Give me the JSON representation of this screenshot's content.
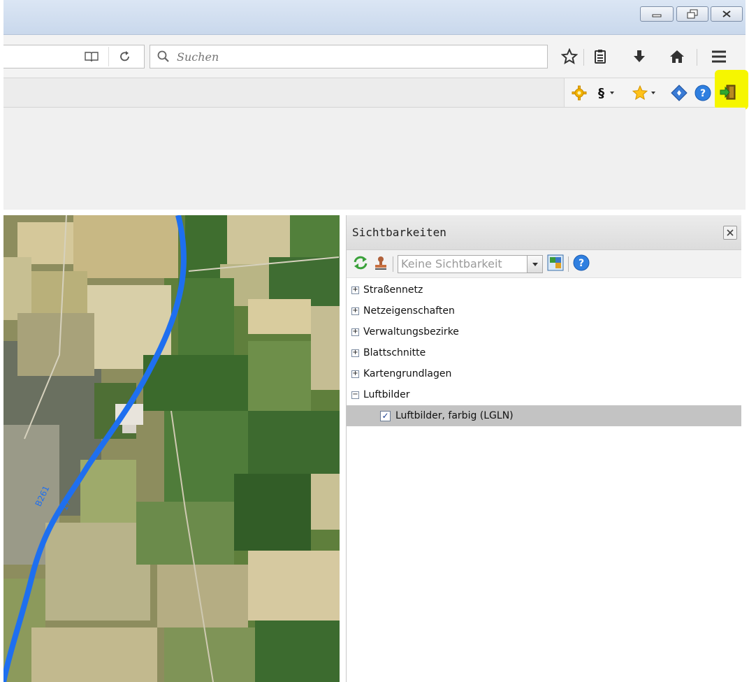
{
  "window": {
    "minimize_icon": "minimize-icon",
    "restore_icon": "restore-icon",
    "close_icon": "close-icon"
  },
  "navbar": {
    "search_placeholder": "Suchen",
    "icons": [
      "reader-view-icon",
      "reload-icon",
      "search-icon",
      "bookmark-star-icon",
      "bookmarks-list-icon",
      "download-icon",
      "home-icon",
      "menu-icon"
    ]
  },
  "addon_toolbar": {
    "paragraph_label": "§",
    "icons": [
      "settings-icon",
      "paragraph-icon",
      "favorites-star-icon",
      "navigation-diamond-icon",
      "help-icon",
      "login-icon"
    ],
    "highlight_color": "#f6f600"
  },
  "map": {
    "road_label_1": "B261",
    "road_label_2": "17",
    "road_color": "#1e6ff0"
  },
  "panel": {
    "title": "Sichtbarkeiten",
    "select_placeholder": "Keine Sichtbarkeit",
    "tree": [
      {
        "label": "Straßennetz",
        "toggle": "+"
      },
      {
        "label": "Netzeigenschaften",
        "toggle": "+"
      },
      {
        "label": "Verwaltungsbezirke",
        "toggle": "+"
      },
      {
        "label": "Blattschnitte",
        "toggle": "+"
      },
      {
        "label": "Kartengrundlagen",
        "toggle": "+"
      },
      {
        "label": "Luftbilder",
        "toggle": "−"
      }
    ],
    "selected_item": {
      "label": "Luftbilder, farbig (LGLN)",
      "checked": "✓"
    }
  }
}
